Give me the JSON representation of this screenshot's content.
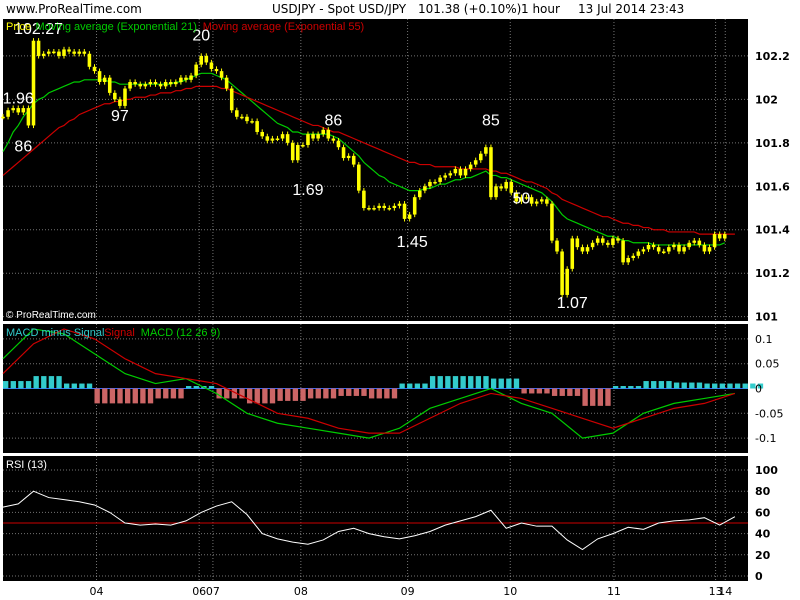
{
  "header": {
    "site": "www.ProRealTime.com",
    "title": "USDJPY - Spot USD/JPY",
    "quote": "101.38 (+0.10%)",
    "interval": "1 hour",
    "datetime": "13 Jul 2014 23:43"
  },
  "watermark": "© ProRealTime.com",
  "colors": {
    "background": "#000000",
    "price": "#ffff00",
    "ema21": "#00cc00",
    "ema55": "#cc0000",
    "macd_line": "#00cc00",
    "signal_line": "#cc0000",
    "hist_pos": "#33cccc",
    "hist_neg": "#cc6666",
    "rsi_line": "#ffffff",
    "rsi_level": "#cc0000",
    "grid": "#ffffff",
    "text": "#ffffff"
  },
  "chart_data": [
    {
      "type": "line",
      "panel": "price",
      "legend": [
        "Price",
        "Moving average (Exponential 21)",
        "Moving average (Exponential 55)"
      ],
      "y_ticks": [
        "102.2",
        "102",
        "101.8",
        "101.6",
        "101.4",
        "101.2",
        "101"
      ],
      "ylim": [
        100.98,
        102.37
      ],
      "x_ticks": [
        "04",
        "06",
        "07",
        "08",
        "09",
        "10",
        "11",
        "13",
        "14"
      ],
      "x_tick_positions": [
        18.4,
        38.6,
        41.3,
        58.6,
        79.6,
        99.8,
        120.2,
        140.2,
        142.1
      ],
      "xlim": [
        0,
        145
      ],
      "annotation_labels": [
        "102.27",
        "1.96",
        "86",
        "97",
        "20",
        "86",
        "1.69",
        "1.45",
        "85",
        "50",
        "1.07"
      ],
      "annotations": [
        {
          "text": "102.27",
          "x": 7.0,
          "y": 102.3
        },
        {
          "text": "1.96",
          "x": 3.0,
          "y": 101.98
        },
        {
          "text": "86",
          "x": 4.0,
          "y": 101.76
        },
        {
          "text": "97",
          "x": 23.0,
          "y": 101.9
        },
        {
          "text": "20",
          "x": 39.0,
          "y": 102.27
        },
        {
          "text": "86",
          "x": 65.0,
          "y": 101.88
        },
        {
          "text": "1.69",
          "x": 60.0,
          "y": 101.56
        },
        {
          "text": "1.45",
          "x": 80.5,
          "y": 101.32
        },
        {
          "text": "85",
          "x": 96.0,
          "y": 101.88
        },
        {
          "text": "50",
          "x": 102.0,
          "y": 101.52
        },
        {
          "text": "1.07",
          "x": 112.0,
          "y": 101.04
        }
      ],
      "series": [
        {
          "name": "Price",
          "values": [
            101.92,
            101.95,
            101.96,
            101.94,
            101.96,
            101.88,
            102.27,
            102.2,
            102.21,
            102.22,
            102.22,
            102.2,
            102.23,
            102.22,
            102.21,
            102.22,
            102.21,
            102.15,
            102.13,
            102.08,
            102.1,
            102.03,
            102.0,
            101.97,
            102.05,
            102.08,
            102.07,
            102.06,
            102.07,
            102.08,
            102.07,
            102.06,
            102.08,
            102.07,
            102.08,
            102.1,
            102.09,
            102.11,
            102.16,
            102.2,
            102.17,
            102.14,
            102.13,
            102.1,
            102.05,
            101.95,
            101.92,
            101.92,
            101.9,
            101.9,
            101.85,
            101.83,
            101.81,
            101.82,
            101.82,
            101.84,
            101.8,
            101.72,
            101.79,
            101.79,
            101.84,
            101.82,
            101.84,
            101.86,
            101.82,
            101.81,
            101.78,
            101.73,
            101.74,
            101.7,
            101.58,
            101.5,
            101.5,
            101.5,
            101.51,
            101.5,
            101.5,
            101.51,
            101.52,
            101.45,
            101.47,
            101.55,
            101.58,
            101.6,
            101.62,
            101.62,
            101.64,
            101.65,
            101.66,
            101.68,
            101.65,
            101.68,
            101.7,
            101.72,
            101.75,
            101.78,
            101.55,
            101.6,
            101.59,
            101.62,
            101.57,
            101.53,
            101.55,
            101.55,
            101.52,
            101.53,
            101.54,
            101.52,
            101.35,
            101.3,
            101.1,
            101.22,
            101.36,
            101.32,
            101.3,
            101.32,
            101.34,
            101.36,
            101.34,
            101.33,
            101.36,
            101.35,
            101.25,
            101.27,
            101.28,
            101.3,
            101.31,
            101.33,
            101.32,
            101.3,
            101.3,
            101.32,
            101.33,
            101.3,
            101.32,
            101.34,
            101.35,
            101.33,
            101.3,
            101.32,
            101.38,
            101.36,
            101.38
          ]
        },
        {
          "name": "Moving average (Exponential 21)",
          "values": [
            101.76,
            101.8,
            101.85,
            101.88,
            101.92,
            101.95,
            101.98,
            102.0,
            102.01,
            102.03,
            102.04,
            102.05,
            102.06,
            102.07,
            102.08,
            102.08,
            102.09,
            102.09,
            102.09,
            102.09,
            102.09,
            102.08,
            102.08,
            102.07,
            102.07,
            102.07,
            102.07,
            102.07,
            102.07,
            102.07,
            102.07,
            102.07,
            102.07,
            102.07,
            102.08,
            102.08,
            102.09,
            102.1,
            102.11,
            102.12,
            102.12,
            102.12,
            102.11,
            102.1,
            102.09,
            102.07,
            102.05,
            102.03,
            102.01,
            101.99,
            101.97,
            101.95,
            101.93,
            101.91,
            101.89,
            101.88,
            101.87,
            101.85,
            101.85,
            101.84,
            101.84,
            101.84,
            101.84,
            101.84,
            101.84,
            101.83,
            101.82,
            101.8,
            101.78,
            101.76,
            101.74,
            101.71,
            101.69,
            101.67,
            101.65,
            101.64,
            101.62,
            101.61,
            101.6,
            101.59,
            101.58,
            101.58,
            101.58,
            101.59,
            101.59,
            101.6,
            101.61,
            101.61,
            101.62,
            101.63,
            101.63,
            101.64,
            101.64,
            101.65,
            101.66,
            101.67,
            101.65,
            101.65,
            101.64,
            101.64,
            101.63,
            101.62,
            101.61,
            101.6,
            101.59,
            101.58,
            101.57,
            101.55,
            101.53,
            101.5,
            101.47,
            101.45,
            101.44,
            101.43,
            101.42,
            101.41,
            101.4,
            101.39,
            101.38,
            101.37,
            101.37,
            101.36,
            101.35,
            101.35,
            101.34,
            101.34,
            101.34,
            101.34,
            101.33,
            101.33,
            101.33,
            101.33,
            101.33,
            101.33,
            101.33,
            101.33,
            101.33,
            101.33,
            101.33,
            101.33,
            101.33,
            101.33,
            101.34
          ]
        },
        {
          "name": "Moving average (Exponential 55)",
          "values": [
            101.65,
            101.67,
            101.69,
            101.71,
            101.73,
            101.75,
            101.77,
            101.79,
            101.81,
            101.83,
            101.85,
            101.87,
            101.88,
            101.9,
            101.91,
            101.93,
            101.94,
            101.95,
            101.96,
            101.97,
            101.98,
            101.98,
            101.99,
            101.99,
            102.0,
            102.0,
            102.01,
            102.01,
            102.01,
            102.02,
            102.02,
            102.03,
            102.03,
            102.03,
            102.04,
            102.04,
            102.05,
            102.05,
            102.06,
            102.06,
            102.06,
            102.06,
            102.06,
            102.05,
            102.05,
            102.04,
            102.03,
            102.02,
            102.01,
            102.0,
            101.99,
            101.98,
            101.97,
            101.96,
            101.95,
            101.94,
            101.93,
            101.92,
            101.91,
            101.9,
            101.89,
            101.88,
            101.88,
            101.87,
            101.86,
            101.85,
            101.85,
            101.84,
            101.83,
            101.82,
            101.81,
            101.8,
            101.79,
            101.78,
            101.77,
            101.76,
            101.75,
            101.74,
            101.73,
            101.72,
            101.71,
            101.71,
            101.7,
            101.7,
            101.7,
            101.69,
            101.69,
            101.69,
            101.69,
            101.69,
            101.68,
            101.68,
            101.68,
            101.68,
            101.68,
            101.68,
            101.67,
            101.67,
            101.66,
            101.66,
            101.65,
            101.64,
            101.63,
            101.62,
            101.62,
            101.61,
            101.6,
            101.59,
            101.57,
            101.56,
            101.54,
            101.53,
            101.52,
            101.51,
            101.5,
            101.49,
            101.48,
            101.47,
            101.46,
            101.46,
            101.45,
            101.44,
            101.43,
            101.43,
            101.42,
            101.42,
            101.41,
            101.41,
            101.4,
            101.4,
            101.4,
            101.39,
            101.39,
            101.39,
            101.39,
            101.39,
            101.39,
            101.38,
            101.38,
            101.38,
            101.38,
            101.38,
            101.38,
            101.38,
            101.38
          ]
        }
      ]
    },
    {
      "type": "line",
      "panel": "macd",
      "legend": [
        "MACD minus Signal",
        "Signal",
        "MACD (12 26 9)"
      ],
      "y_ticks": [
        "0.1",
        "0.05",
        "0",
        "-0.05",
        "-0.1"
      ],
      "ylim": [
        -0.13,
        0.13
      ],
      "x": [
        0,
        6,
        12,
        18,
        24,
        30,
        36,
        42,
        48,
        54,
        60,
        66,
        72,
        78,
        84,
        90,
        96,
        102,
        108,
        114,
        120,
        126,
        132,
        138,
        144
      ],
      "series": [
        {
          "name": "MACD (12 26 9)",
          "values": [
            0.06,
            0.12,
            0.11,
            0.07,
            0.03,
            0.01,
            0.02,
            -0.01,
            -0.05,
            -0.07,
            -0.08,
            -0.09,
            -0.1,
            -0.08,
            -0.04,
            -0.02,
            0.0,
            -0.03,
            -0.05,
            -0.1,
            -0.09,
            -0.05,
            -0.03,
            -0.02,
            -0.01
          ]
        },
        {
          "name": "Signal",
          "values": [
            0.03,
            0.09,
            0.12,
            0.1,
            0.06,
            0.03,
            0.02,
            0.01,
            -0.02,
            -0.05,
            -0.06,
            -0.08,
            -0.09,
            -0.09,
            -0.06,
            -0.03,
            -0.01,
            -0.02,
            -0.04,
            -0.06,
            -0.08,
            -0.06,
            -0.04,
            -0.03,
            -0.01
          ]
        },
        {
          "name": "MACD minus Signal",
          "values": [
            0.015,
            0.025,
            0.01,
            -0.03,
            -0.03,
            -0.02,
            0.005,
            -0.02,
            -0.03,
            -0.025,
            -0.02,
            -0.015,
            -0.02,
            0.01,
            0.025,
            0.025,
            0.02,
            -0.01,
            -0.015,
            -0.035,
            0.005,
            0.015,
            0.012,
            0.01,
            0.01
          ]
        }
      ]
    },
    {
      "type": "line",
      "panel": "rsi",
      "legend": [
        "RSI (13)"
      ],
      "y_ticks": [
        "100",
        "80",
        "60",
        "40",
        "20",
        "0"
      ],
      "ylim": [
        0,
        100
      ],
      "reference_level": 50,
      "x": [
        0,
        3,
        6,
        9,
        12,
        15,
        18,
        21,
        24,
        27,
        30,
        33,
        36,
        39,
        42,
        45,
        48,
        51,
        54,
        57,
        60,
        63,
        66,
        69,
        72,
        75,
        78,
        81,
        84,
        87,
        90,
        93,
        96,
        99,
        102,
        105,
        108,
        111,
        114,
        117,
        120,
        123,
        126,
        129,
        132,
        135,
        138,
        141,
        144
      ],
      "series": [
        {
          "name": "RSI (13)",
          "values": [
            65,
            68,
            80,
            74,
            72,
            70,
            67,
            60,
            50,
            48,
            49,
            48,
            52,
            60,
            66,
            70,
            58,
            40,
            35,
            32,
            30,
            34,
            42,
            45,
            40,
            37,
            35,
            38,
            42,
            48,
            52,
            56,
            62,
            45,
            50,
            47,
            47,
            34,
            25,
            35,
            40,
            46,
            44,
            50,
            52,
            53,
            55,
            48,
            56
          ]
        }
      ]
    }
  ]
}
